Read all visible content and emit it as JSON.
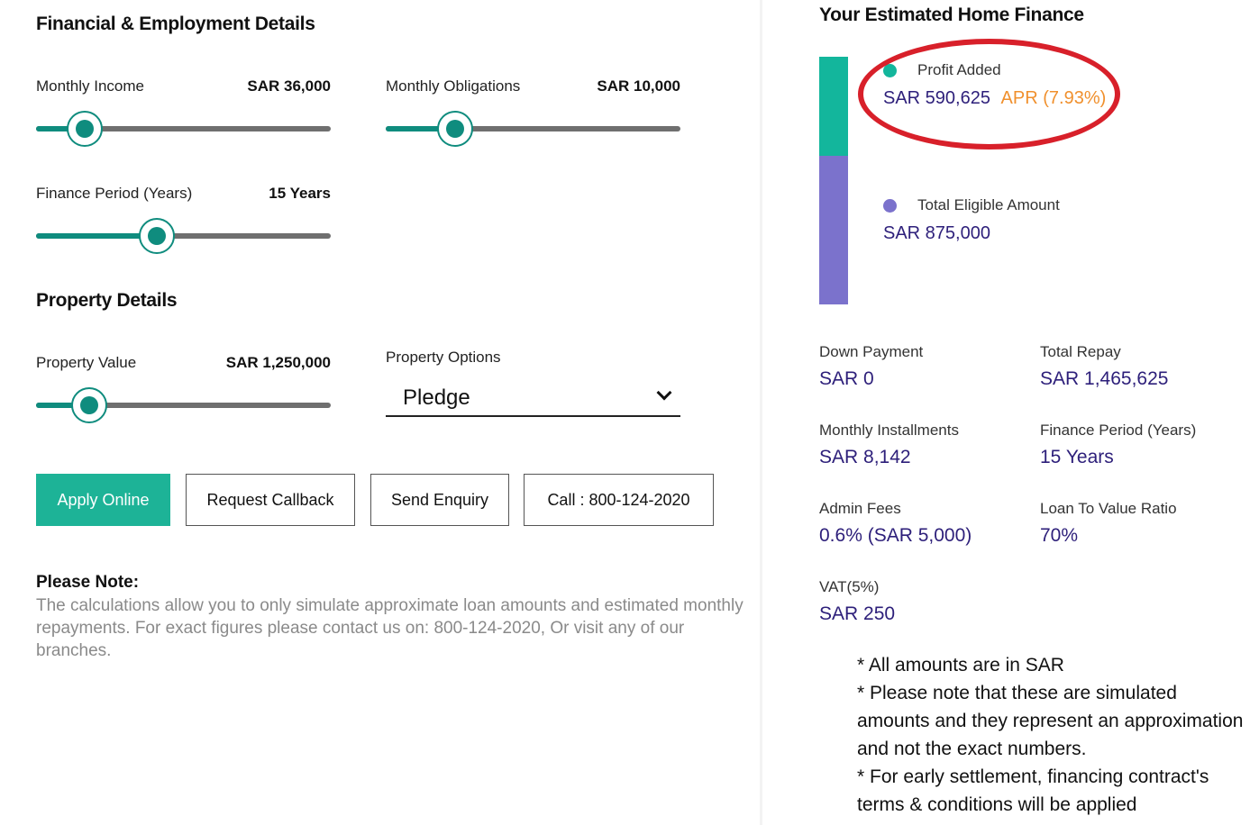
{
  "financial_section": {
    "title": "Financial & Employment Details",
    "monthly_income": {
      "label": "Monthly Income",
      "value": "SAR 36,000",
      "level": 0.165
    },
    "monthly_obligations": {
      "label": "Monthly Obligations",
      "value": "SAR 10,000",
      "level": 0.235
    },
    "finance_period": {
      "label": "Finance Period (Years)",
      "value": "15 Years",
      "level": 0.41
    }
  },
  "property_section": {
    "title": "Property Details",
    "property_value": {
      "label": "Property Value",
      "value": "SAR 1,250,000",
      "level": 0.18
    },
    "property_options": {
      "label": "Property Options",
      "selected": "Pledge"
    }
  },
  "buttons": {
    "apply_online": "Apply Online",
    "request_callback": "Request Callback",
    "send_enquiry": "Send Enquiry",
    "call": "Call : 800-124-2020"
  },
  "note": {
    "title": "Please Note:",
    "text": "The calculations allow you to only simulate approximate loan amounts and estimated monthly repayments. For exact figures please contact us on: 800-124-2020, Or visit any of our branches."
  },
  "estimate": {
    "title": "Your Estimated Home Finance",
    "profit_added": {
      "label": "Profit Added",
      "value": "SAR 590,625",
      "apr": "APR (7.93%)",
      "color": "#13b69c"
    },
    "total_eligible": {
      "label": "Total Eligible Amount",
      "value": "SAR 875,000",
      "color": "#7b72cc"
    },
    "stats": {
      "down_payment": {
        "label": "Down Payment",
        "value": "SAR 0"
      },
      "total_repay": {
        "label": "Total Repay",
        "value": "SAR 1,465,625"
      },
      "monthly_installments": {
        "label": "Monthly Installments",
        "value": "SAR 8,142"
      },
      "finance_period": {
        "label": "Finance Period (Years)",
        "value": "15 Years"
      },
      "admin_fees": {
        "label": "Admin Fees",
        "value": "0.6% (SAR 5,000)"
      },
      "ltv": {
        "label": "Loan To Value Ratio",
        "value": "70%"
      },
      "vat": {
        "label": "VAT(5%)",
        "value": "SAR 250"
      }
    },
    "disclaimers": [
      "* All amounts are in SAR",
      "* Please note that these are simulated amounts and they represent an approximation and not the exact numbers.",
      "* For early settlement, financing contract's terms & conditions will be applied"
    ]
  },
  "colors": {
    "accent": "#1db397",
    "slider": "#0f8c7e",
    "value_text": "#2d1f7a",
    "apr": "#f0902d",
    "annotation": "#d8202a"
  }
}
